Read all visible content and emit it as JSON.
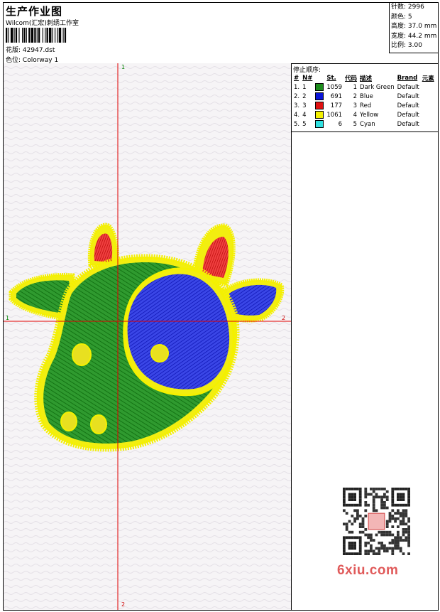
{
  "header": {
    "title": "生产作业图",
    "company": "Wilcom(汇宏)刺绣工作室",
    "design_label": "花版:",
    "design_value": "42947.dst",
    "colorway_label": "色位:",
    "colorway_value": "Colorway 1"
  },
  "stats": [
    {
      "label": "针数:",
      "value": "2996"
    },
    {
      "label": "颜色:",
      "value": "5"
    },
    {
      "label": "高度:",
      "value": "37.0 mm"
    },
    {
      "label": "宽度:",
      "value": "44.2 mm"
    },
    {
      "label": "比例:",
      "value": "3.00"
    }
  ],
  "axes": {
    "top": "1",
    "bottom": "2",
    "left": "1",
    "right": "2"
  },
  "stop_sequence": {
    "title": "停止顺序:",
    "columns": [
      "#",
      "N#",
      "St.",
      "代码",
      "描述",
      "Brand",
      "元素"
    ],
    "rows": [
      {
        "index": "1.",
        "n": "1",
        "color": "#1c8c1c",
        "stitches": "1059",
        "code": "1",
        "desc": "Dark Green",
        "brand": "Default"
      },
      {
        "index": "2.",
        "n": "2",
        "color": "#0a14d8",
        "stitches": "691",
        "code": "2",
        "desc": "Blue",
        "brand": "Default"
      },
      {
        "index": "3.",
        "n": "3",
        "color": "#e01010",
        "stitches": "177",
        "code": "3",
        "desc": "Red",
        "brand": "Default"
      },
      {
        "index": "4.",
        "n": "4",
        "color": "#f4f000",
        "stitches": "1061",
        "code": "4",
        "desc": "Yellow",
        "brand": "Default"
      },
      {
        "index": "5.",
        "n": "5",
        "color": "#30e0e0",
        "stitches": "6",
        "code": "5",
        "desc": "Cyan",
        "brand": "Default"
      }
    ]
  },
  "watermark": {
    "brand": "6xiu.com"
  }
}
